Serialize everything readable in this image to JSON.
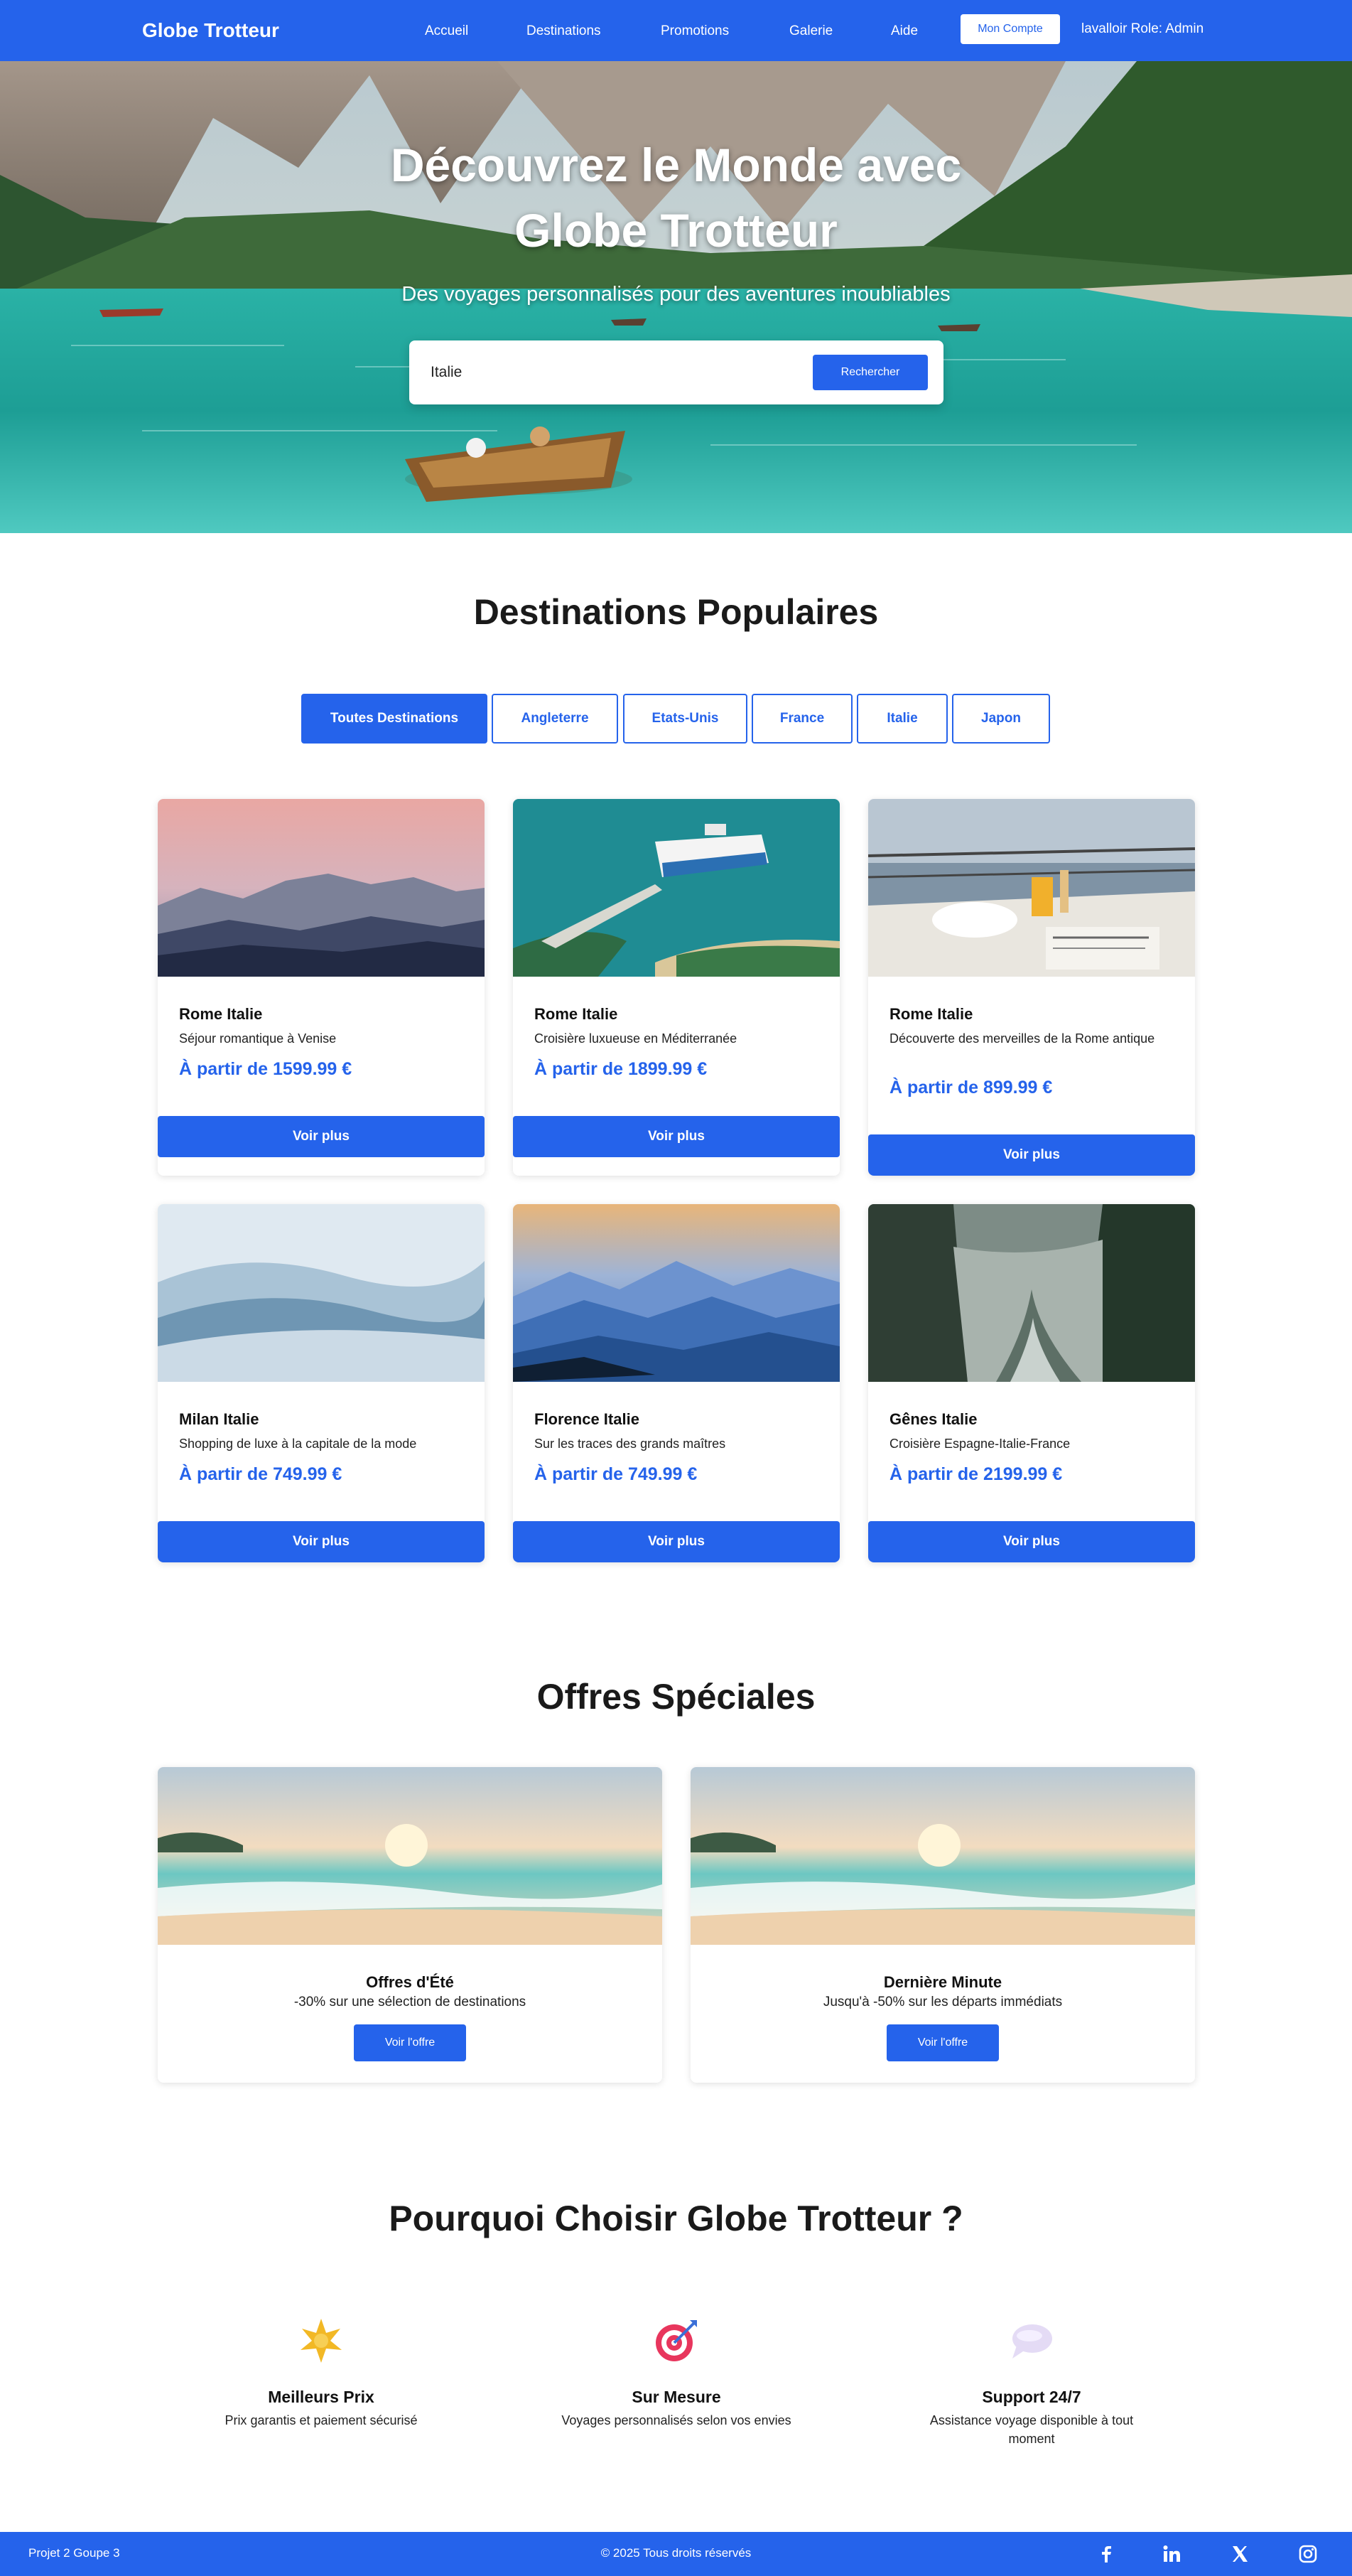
{
  "nav": {
    "brand": "Globe Trotteur",
    "links": [
      "Accueil",
      "Destinations",
      "Promotions",
      "Galerie",
      "Aide"
    ],
    "account_button": "Mon Compte",
    "user_info": "lavalloir Role: Admin"
  },
  "hero": {
    "title_line1": "Découvrez le Monde avec",
    "title_line2": "Globe Trotteur",
    "subtitle": "Des voyages personnalisés pour des aventures inoubliables",
    "search_value": "Italie",
    "search_button": "Rechercher"
  },
  "destinations": {
    "title": "Destinations Populaires",
    "filters": [
      "Toutes Destinations",
      "Angleterre",
      "Etats-Unis",
      "France",
      "Italie",
      "Japon"
    ],
    "active_filter": "Toutes Destinations",
    "cards": [
      {
        "title": "Rome Italie",
        "desc": "Séjour romantique à Venise",
        "price": "À partir de 1599.99 €",
        "button": "Voir plus",
        "image": "pink-sunset-mountains"
      },
      {
        "title": "Rome Italie",
        "desc": "Croisière luxueuse en Méditerranée",
        "price": "À partir de 1899.99 €",
        "button": "Voir plus",
        "image": "cruise-ship-island"
      },
      {
        "title": "Rome Italie",
        "desc": "Découverte des merveilles de la Rome antique",
        "price": "À partir de 899.99 €",
        "button": "Voir plus",
        "image": "breakfast-on-deck"
      },
      {
        "title": "Milan Italie",
        "desc": "Shopping de luxe à la capitale de la mode",
        "price": "À partir de 749.99 €",
        "button": "Voir plus",
        "image": "misty-blue-hills"
      },
      {
        "title": "Florence Italie",
        "desc": "Sur les traces des grands maîtres",
        "price": "À partir de 749.99 €",
        "button": "Voir plus",
        "image": "blue-mountain-layers"
      },
      {
        "title": "Gênes Italie",
        "desc": "Croisière Espagne-Italie-France",
        "price": "À partir de 2199.99 €",
        "button": "Voir plus",
        "image": "foggy-forest-river"
      }
    ]
  },
  "offers": {
    "title": "Offres Spéciales",
    "items": [
      {
        "title": "Offres d'Été",
        "desc": "-30% sur une sélection de destinations",
        "button": "Voir l'offre",
        "image": "beach-sunset"
      },
      {
        "title": "Dernière Minute",
        "desc": "Jusqu'à -50% sur les départs immédiats",
        "button": "Voir l'offre",
        "image": "beach-sunset"
      }
    ]
  },
  "features": {
    "title": "Pourquoi Choisir Globe Trotteur ?",
    "items": [
      {
        "title": "Meilleurs Prix",
        "desc": "Prix garantis et paiement sécurisé",
        "icon": "sparkle-icon"
      },
      {
        "title": "Sur Mesure",
        "desc": "Voyages personnalisés selon vos envies",
        "icon": "target-icon"
      },
      {
        "title": "Support 24/7",
        "desc": "Assistance voyage disponible à tout moment",
        "icon": "speech-bubble-icon"
      }
    ]
  },
  "footer": {
    "left": "Projet 2 Goupe 3",
    "center": "© 2025 Tous droits réservés",
    "socials": [
      "facebook-icon",
      "linkedin-icon",
      "x-icon",
      "instagram-icon"
    ]
  },
  "colors": {
    "primary": "#2563eb",
    "background": "#ffffff",
    "text": "#111111"
  }
}
